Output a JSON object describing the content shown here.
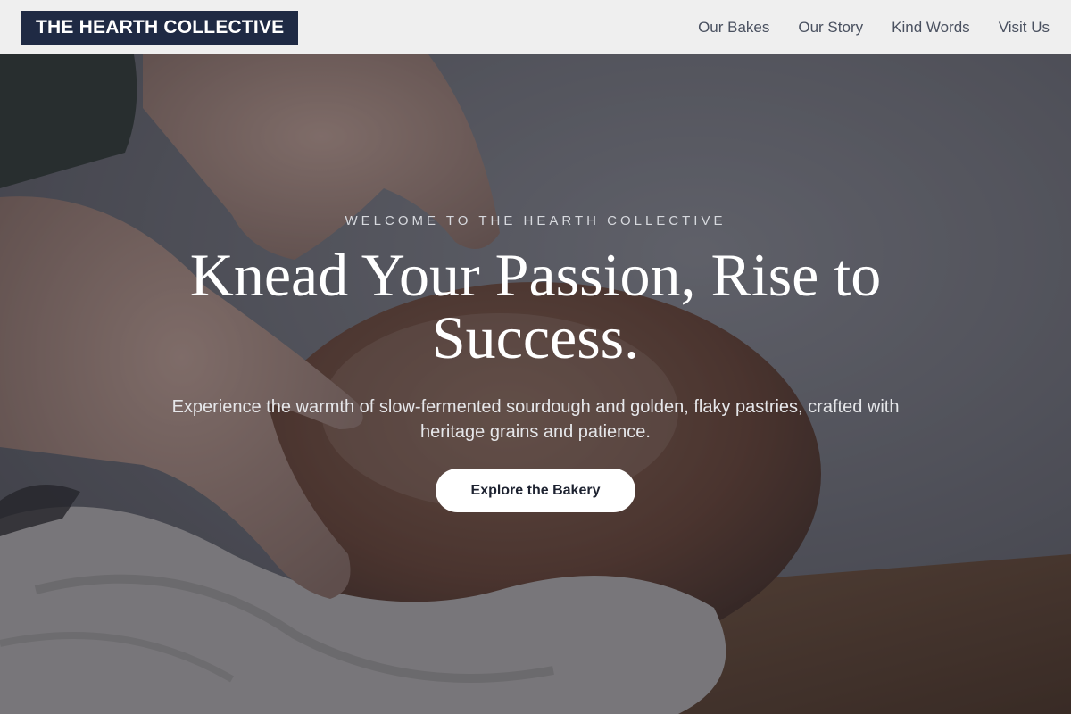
{
  "nav": {
    "brand": "THE HEARTH COLLECTIVE",
    "links": [
      "Our Bakes",
      "Our Story",
      "Kind Words",
      "Visit Us"
    ]
  },
  "hero": {
    "eyebrow": "WELCOME TO THE HEARTH COLLECTIVE",
    "headline_line1": "Knead Your Passion, Rise to",
    "headline_line2": "Success.",
    "subtext_line1": "Experience the warmth of slow-fermented sourdough and golden, flaky pastries, crafted with",
    "subtext_line2": "heritage grains and patience.",
    "cta_label": "Explore the Bakery"
  },
  "colors": {
    "brand_bg": "#1f2a44",
    "nav_bg": "#efefef",
    "nav_link": "#4a5160",
    "cta_bg": "#ffffff",
    "cta_text": "#1d2230"
  }
}
